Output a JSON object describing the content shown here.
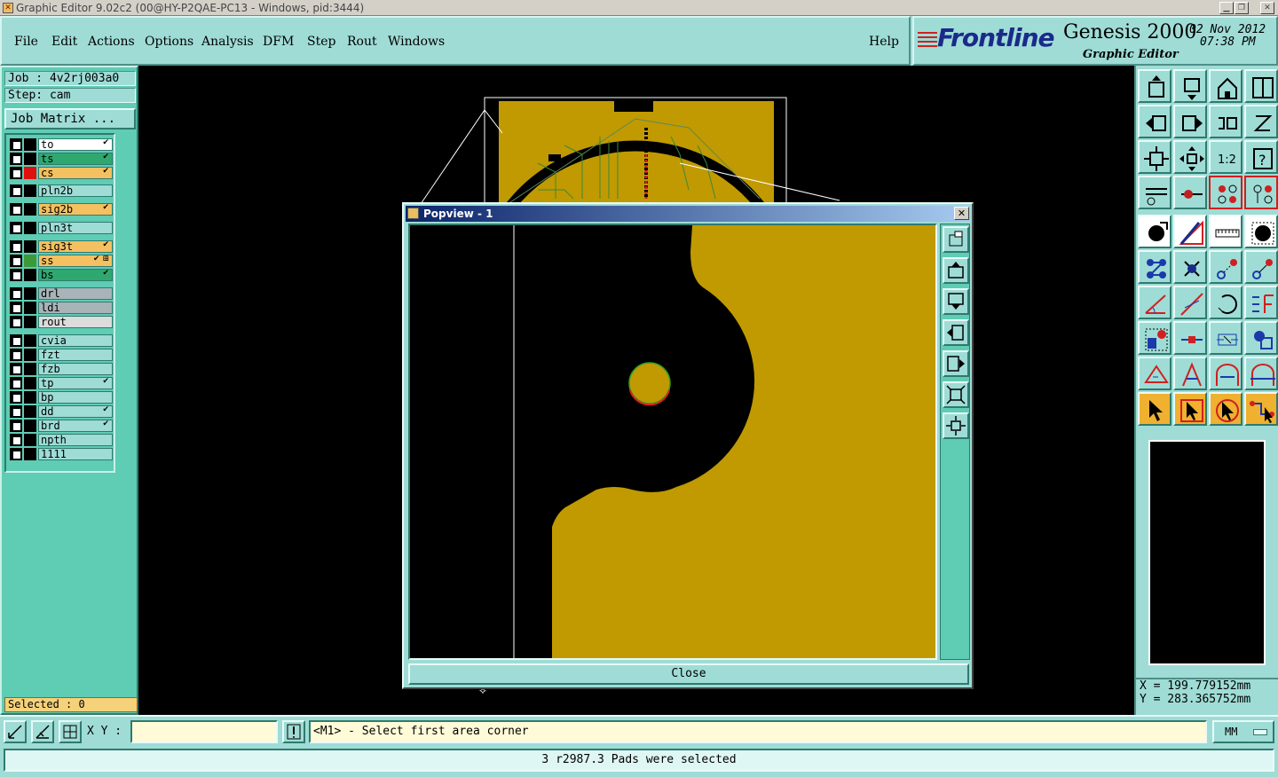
{
  "window": {
    "title": "Graphic Editor 9.02c2 (00@HY-P2QAE-PC13 - Windows, pid:3444)"
  },
  "menu": {
    "items": [
      "File",
      "Edit",
      "Actions",
      "Options",
      "Analysis",
      "DFM",
      "Step",
      "Rout",
      "Windows"
    ],
    "help": "Help"
  },
  "logo": {
    "brand": "Frontline",
    "product": "Genesis 2000",
    "subtitle": "Graphic Editor",
    "date": "02 Nov 2012",
    "time": "07:38 PM"
  },
  "job": {
    "job_label": "Job : 4v2rj003a0",
    "step_label": "Step: cam",
    "matrix_button": "Job Matrix ..."
  },
  "layers": [
    {
      "name": "to",
      "bg": "#ffffff",
      "color": "#000000",
      "mark": "✔"
    },
    {
      "name": "ts",
      "bg": "#2fa86f",
      "color": "#000000",
      "mark": "✔"
    },
    {
      "name": "cs",
      "bg": "#f5c060",
      "color": "#e01010",
      "mark": "✔"
    },
    {
      "name": "pln2b",
      "bg": "#9fdcd6",
      "color": "#000000",
      "mark": ""
    },
    {
      "name": "sig2b",
      "bg": "#f5c060",
      "color": "#000000",
      "mark": "✔"
    },
    {
      "name": "pln3t",
      "bg": "#9fdcd6",
      "color": "#000000",
      "mark": ""
    },
    {
      "name": "sig3t",
      "bg": "#f5c060",
      "color": "#000000",
      "mark": "✔"
    },
    {
      "name": "ss",
      "bg": "#f5c060",
      "color": "#3a9a3a",
      "mark": "✔ ⊞"
    },
    {
      "name": "bs",
      "bg": "#2fa86f",
      "color": "#000000",
      "mark": "✔"
    },
    {
      "name": "drl",
      "bg": "#a8b4b8",
      "color": "#000000",
      "mark": ""
    },
    {
      "name": "ldi",
      "bg": "#a8b4b8",
      "color": "#000000",
      "mark": ""
    },
    {
      "name": "rout",
      "bg": "#dcdcdc",
      "color": "#000000",
      "mark": ""
    },
    {
      "name": "cvia",
      "bg": "#9fdcd6",
      "color": "#000000",
      "mark": ""
    },
    {
      "name": "fzt",
      "bg": "#9fdcd6",
      "color": "#000000",
      "mark": ""
    },
    {
      "name": "fzb",
      "bg": "#9fdcd6",
      "color": "#000000",
      "mark": ""
    },
    {
      "name": "tp",
      "bg": "#9fdcd6",
      "color": "#000000",
      "mark": "✔"
    },
    {
      "name": "bp",
      "bg": "#9fdcd6",
      "color": "#000000",
      "mark": ""
    },
    {
      "name": "dd",
      "bg": "#9fdcd6",
      "color": "#000000",
      "mark": "✔"
    },
    {
      "name": "brd",
      "bg": "#9fdcd6",
      "color": "#000000",
      "mark": "✔"
    },
    {
      "name": "npth",
      "bg": "#9fdcd6",
      "color": "#000000",
      "mark": ""
    },
    {
      "name": "1111",
      "bg": "#9fdcd6",
      "color": "#000000",
      "mark": ""
    }
  ],
  "selected": "Selected : 0",
  "popview": {
    "title": "Popview - 1",
    "close_label": "Close"
  },
  "coords": {
    "x": "X = 199.779152mm",
    "y": "Y = 283.365752mm"
  },
  "command": {
    "xy_label": "X Y :",
    "xy_value": "",
    "prompt": "<M1> - Select first area corner",
    "units": "MM"
  },
  "status": "3 r2987.3 Pads were selected",
  "colors": {
    "copper": "#c09a00",
    "panel": "#9fdcd6",
    "layer_panel": "#5fccb4",
    "highlight": "#f5c060"
  }
}
